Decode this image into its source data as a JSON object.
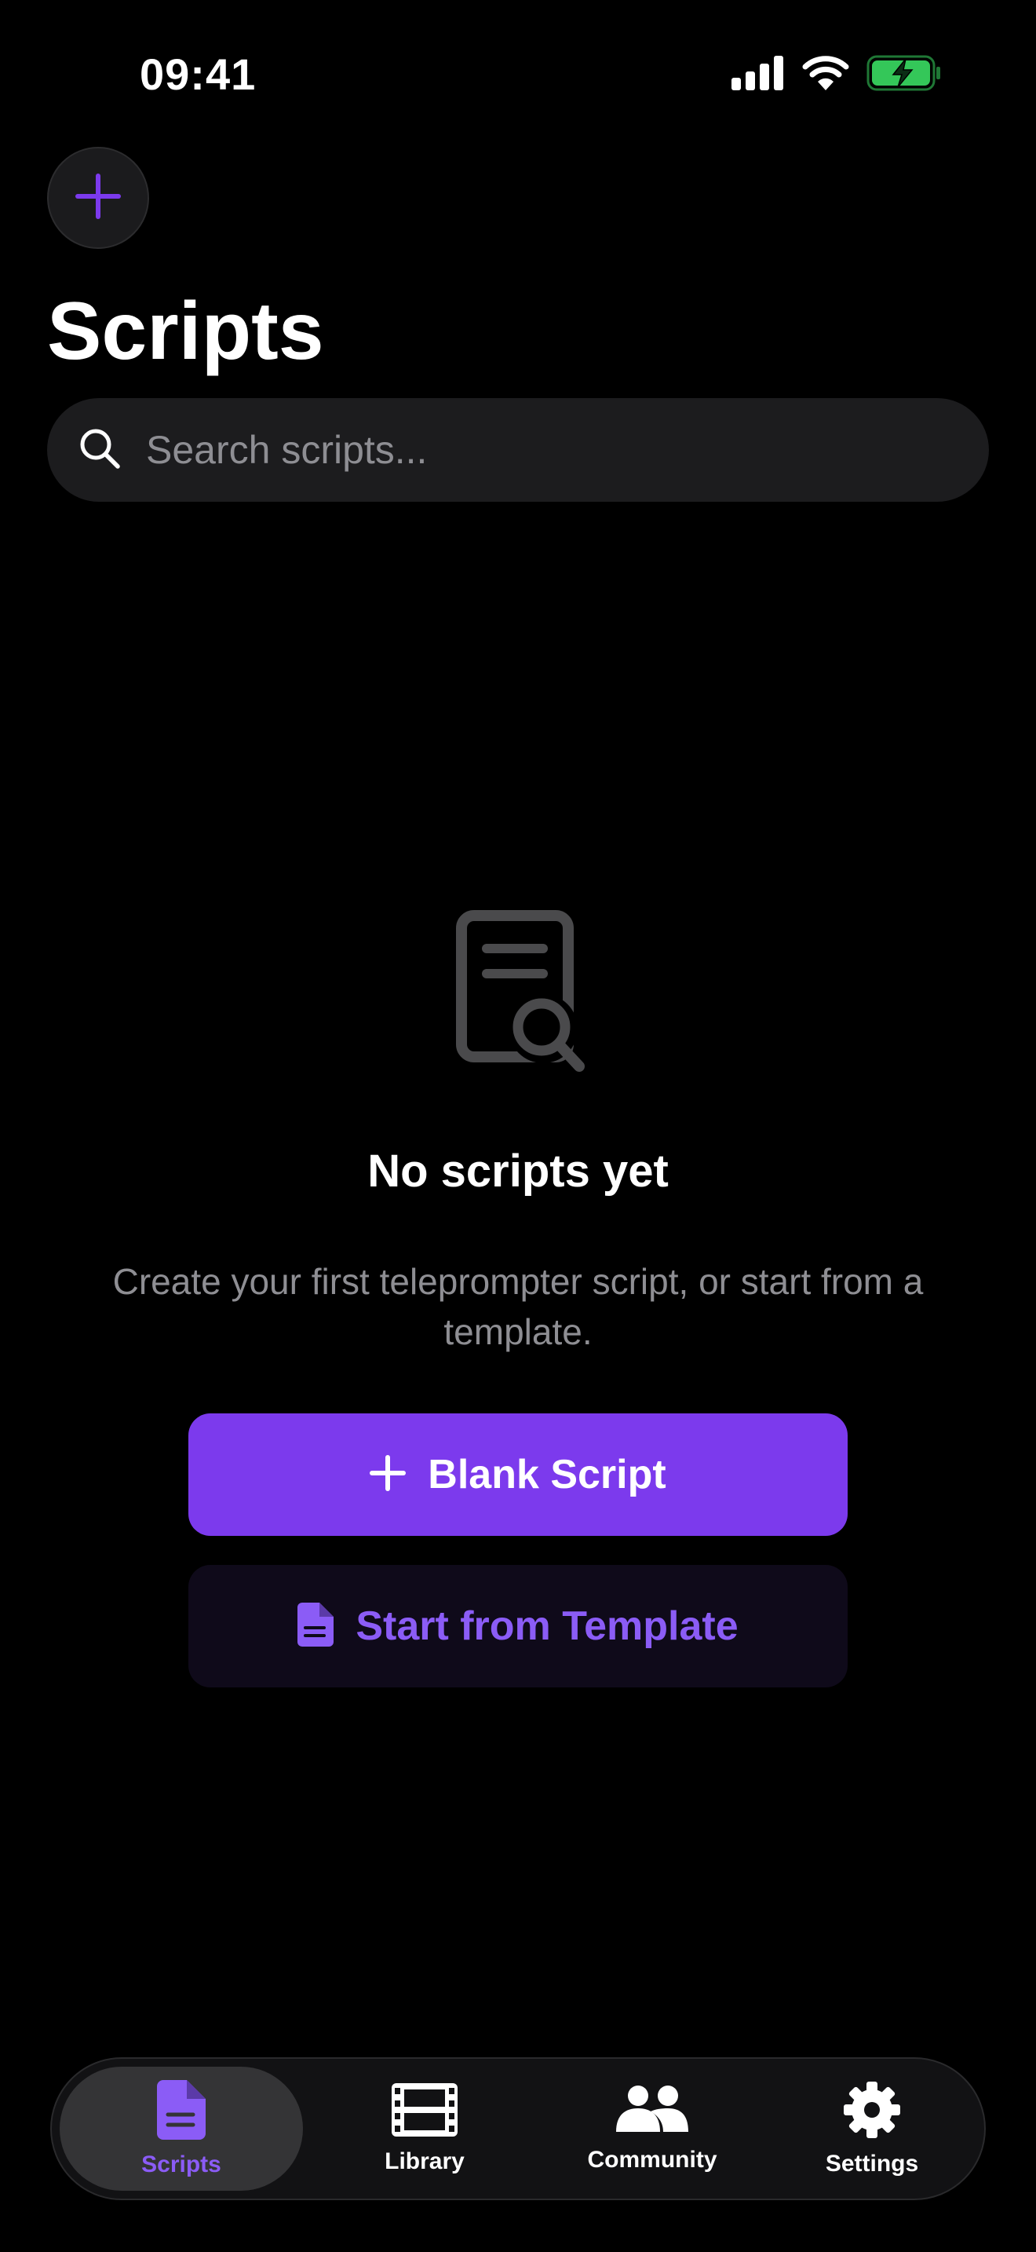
{
  "status_bar": {
    "time": "09:41",
    "icons": [
      "cellular-signal-icon",
      "wifi-icon",
      "battery-charging-icon"
    ],
    "battery_color": "#34c759"
  },
  "header": {
    "add_icon": "plus-icon",
    "title": "Scripts"
  },
  "search": {
    "icon": "search-icon",
    "placeholder": "Search scripts...",
    "value": ""
  },
  "empty_state": {
    "icon": "document-search-icon",
    "title": "No scripts yet",
    "subtitle": "Create your first teleprompter script, or start from a template."
  },
  "actions": {
    "blank": {
      "icon": "plus-icon",
      "label": "Blank Script"
    },
    "template": {
      "icon": "document-icon",
      "label": "Start from Template"
    }
  },
  "tabs": [
    {
      "label": "Scripts",
      "icon": "document-icon",
      "active": true
    },
    {
      "label": "Library",
      "icon": "film-icon",
      "active": false
    },
    {
      "label": "Community",
      "icon": "people-icon",
      "active": false
    },
    {
      "label": "Settings",
      "icon": "gear-icon",
      "active": false
    }
  ],
  "colors": {
    "accent": "#7c3aed",
    "accent_text": "#8b5cf6",
    "background": "#000000",
    "muted_text": "#8e8e93"
  }
}
